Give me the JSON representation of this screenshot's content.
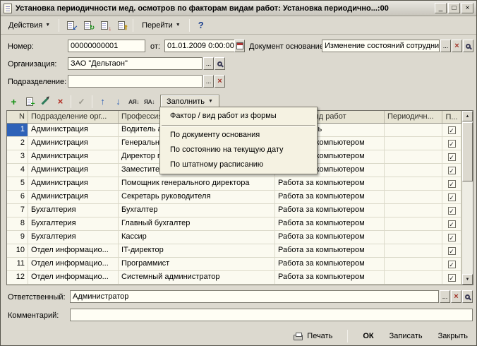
{
  "window": {
    "title": "Установка периодичности мед. осмотров по факторам видам работ: Установка периодично...:00",
    "minimize": "_",
    "maximize": "□",
    "close": "×"
  },
  "toolbar": {
    "actions": "Действия",
    "goto": "Перейти",
    "fill": "Заполнить"
  },
  "fields": {
    "number": {
      "label": "Номер:",
      "value": "00000000001"
    },
    "date": {
      "label": "от:",
      "value": "01.01.2009 0:00:00"
    },
    "basis": {
      "label": "Документ основание:",
      "value": "Изменение состояний сотрудни"
    },
    "organization": {
      "label": "Организация:",
      "value": "ЗАО \"Дельтаон\""
    },
    "department": {
      "label": "Подразделение:",
      "value": ""
    },
    "responsible": {
      "label": "Ответственный:",
      "value": "Администратор"
    },
    "comment": {
      "label": "Комментарий:",
      "value": ""
    }
  },
  "menu": {
    "items": [
      "Фактор / вид работ из формы",
      "По документу основания",
      "По состоянию на текущую дату",
      "По штатному расписанию"
    ]
  },
  "table": {
    "columns": [
      "N",
      "Подразделение орг...",
      "Профессия",
      "Фактор / вид работ",
      "Периодичн...",
      "П..."
    ],
    "rows": [
      {
        "n": "1",
        "dept": "Администрация",
        "prof": "Водитель автомобиля",
        "factor": "Автомобиль",
        "period": "",
        "checked": true
      },
      {
        "n": "2",
        "dept": "Администрация",
        "prof": "Генеральный директор",
        "factor": "Работа за компьютером",
        "period": "",
        "checked": true
      },
      {
        "n": "3",
        "dept": "Администрация",
        "prof": "Директор по персоналу",
        "factor": "Работа за компьютером",
        "period": "",
        "checked": true
      },
      {
        "n": "4",
        "dept": "Администрация",
        "prof": "Заместитель генерального директора",
        "factor": "Работа за компьютером",
        "period": "",
        "checked": true
      },
      {
        "n": "5",
        "dept": "Администрация",
        "prof": "Помощник генерального директора",
        "factor": "Работа за компьютером",
        "period": "",
        "checked": true
      },
      {
        "n": "6",
        "dept": "Администрация",
        "prof": "Секретарь руководителя",
        "factor": "Работа за компьютером",
        "period": "",
        "checked": true
      },
      {
        "n": "7",
        "dept": "Бухгалтерия",
        "prof": "Бухгалтер",
        "factor": "Работа за компьютером",
        "period": "",
        "checked": true
      },
      {
        "n": "8",
        "dept": "Бухгалтерия",
        "prof": "Главный бухгалтер",
        "factor": "Работа за компьютером",
        "period": "",
        "checked": true
      },
      {
        "n": "9",
        "dept": "Бухгалтерия",
        "prof": "Кассир",
        "factor": "Работа за компьютером",
        "period": "",
        "checked": true
      },
      {
        "n": "10",
        "dept": "Отдел информацио...",
        "prof": "IT-директор",
        "factor": "Работа за компьютером",
        "period": "",
        "checked": true
      },
      {
        "n": "11",
        "dept": "Отдел информацио...",
        "prof": "Программист",
        "factor": "Работа за компьютером",
        "period": "",
        "checked": true
      },
      {
        "n": "12",
        "dept": "Отдел информацио...",
        "prof": "Системный администратор",
        "factor": "Работа за компьютером",
        "period": "",
        "checked": true
      }
    ]
  },
  "footer": {
    "print": "Печать",
    "ok": "ОК",
    "save": "Записать",
    "close": "Закрыть"
  },
  "icons": {
    "menu_arrow": "▼",
    "help": "?",
    "add": "+",
    "delete": "×",
    "end_edit": "✓",
    "up": "↑",
    "down": "↓",
    "sort_asc": "АЯ↓",
    "sort_desc": "ЯА↓",
    "ellipsis": "...",
    "clear": "×",
    "scroll_up": "▲",
    "scroll_down": "▼"
  }
}
